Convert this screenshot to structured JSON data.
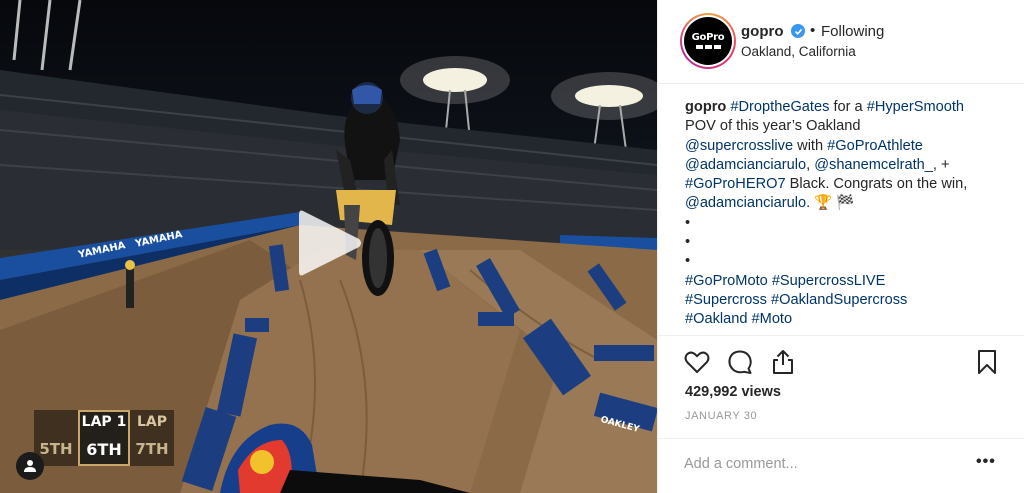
{
  "post": {
    "video": {
      "lap_label": "LAP 1",
      "lap_next_label": "LAP",
      "position_left": "5TH",
      "position_current": "6TH",
      "position_right": "7TH",
      "sponsor_text_1": "YAMAHA",
      "sponsor_text_2": "YAMAHA",
      "sponsor_text_3": "OAKLEY"
    },
    "header": {
      "username": "gopro",
      "separator": "•",
      "follow_status": "Following",
      "location": "Oakland, California",
      "avatar_text": "GoPro"
    },
    "caption": {
      "author": "gopro",
      "line1_tag1": "#DroptheGates",
      "line1_text": " for a ",
      "line1_tag2": "#HyperSmooth",
      "line2_text": "POV of this year’s Oakland",
      "line3_tag1": "@supercrosslive",
      "line3_text": " with ",
      "line3_tag2": "#GoProAthlete",
      "line4_tag1": "@adamcianciarulo",
      "line4_text1": ", ",
      "line4_tag2": "@shanemcelrath_",
      "line4_text2": ", +",
      "line5_tag1": "#GoProHERO7",
      "line5_text": " Black. Congrats on the win,",
      "line6_tag1": "@adamcianciarulo",
      "line6_text": ". 🏆 🏁",
      "dot": "•",
      "line10_tag1": "#GoProMoto",
      "line10_tag2": "#SupercrossLIVE",
      "line11_tag1": "#Supercross",
      "line11_tag2": "#OaklandSupercross",
      "line12_tag1": "#Oakland",
      "line12_tag2": "#Moto"
    },
    "stats": {
      "views": "429,992 views",
      "date": "JANUARY 30"
    },
    "comment": {
      "placeholder": "Add a comment...",
      "more": "•••"
    }
  }
}
